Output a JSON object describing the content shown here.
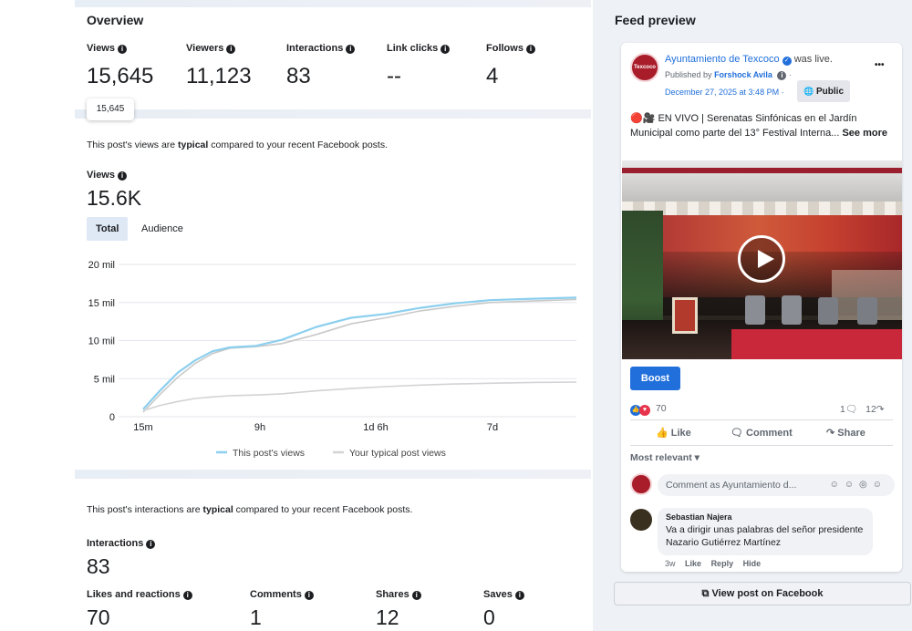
{
  "overview": {
    "title": "Overview",
    "metrics": [
      {
        "label": "Views",
        "value": "15,645"
      },
      {
        "label": "Viewers",
        "value": "11,123"
      },
      {
        "label": "Interactions",
        "value": "83"
      },
      {
        "label": "Link clicks",
        "value": "--"
      },
      {
        "label": "Follows",
        "value": "4"
      }
    ],
    "tooltip": "15,645"
  },
  "views_section": {
    "typical_prefix": "This post's views are ",
    "typical_word": "typical",
    "typical_suffix": " compared to your recent Facebook posts.",
    "label": "Views",
    "value": "15.6K",
    "tabs": [
      "Total",
      "Audience"
    ]
  },
  "chart_data": {
    "type": "line",
    "y_ticks": [
      "0",
      "5 mil",
      "10 mil",
      "15 mil",
      "20 mil"
    ],
    "x_ticks": [
      "15m",
      "9h",
      "1d 6h",
      "7d"
    ],
    "ylim": [
      0,
      20000
    ],
    "x": [
      0,
      4,
      8,
      12,
      16,
      20,
      26,
      32,
      40,
      48,
      56,
      64,
      72,
      80,
      90,
      100
    ],
    "series": [
      {
        "name": "This post's views",
        "color": "#8ccfee",
        "values": [
          1000,
          3500,
          5800,
          7400,
          8600,
          9100,
          9300,
          10100,
          11800,
          13000,
          13500,
          14300,
          14900,
          15300,
          15500,
          15645
        ]
      },
      {
        "name": "Your typical post views",
        "color": "#d3d3d3",
        "values": [
          800,
          1500,
          2000,
          2400,
          2600,
          2750,
          2850,
          3000,
          3400,
          3700,
          3950,
          4150,
          4300,
          4400,
          4500,
          4550
        ]
      },
      {
        "name": "",
        "color": "#c9c9c9",
        "values": [
          600,
          3000,
          5200,
          7000,
          8300,
          9000,
          9200,
          9600,
          10800,
          12200,
          13000,
          13900,
          14500,
          15000,
          15200,
          15400
        ]
      }
    ],
    "legend": [
      "This post's views",
      "Your typical post views"
    ]
  },
  "interactions_section": {
    "typical_prefix": "This post's interactions are ",
    "typical_word": "typical",
    "typical_suffix": " compared to your recent Facebook posts.",
    "label": "Interactions",
    "value": "83",
    "breakdown": [
      {
        "label": "Likes and reactions",
        "value": "70"
      },
      {
        "label": "Comments",
        "value": "1"
      },
      {
        "label": "Shares",
        "value": "12"
      },
      {
        "label": "Saves",
        "value": "0"
      }
    ]
  },
  "feed": {
    "title": "Feed preview",
    "page_name": "Ayuntamiento de Texcoco",
    "was_live": "was live.",
    "published_by": "Published by",
    "publisher": "Forshock Avila",
    "date": "December 27, 2025 at 3:48 PM",
    "audience": "Public",
    "more": "•••",
    "text_main": "🔴🎥 EN VIVO | Serenatas Sinfónicas en el Jardín Municipal como parte del 13° Festival Interna...",
    "see_more": "See more",
    "boost": "Boost",
    "reaction_count": "70",
    "comment_count": "1",
    "share_count": "12",
    "actions": [
      "Like",
      "Comment",
      "Share"
    ],
    "most_relevant": "Most relevant",
    "comment_placeholder": "Comment as Ayuntamiento d...",
    "avatar_text": "Texcoco",
    "comment": {
      "author": "Sebastian Najera",
      "text": "Va a dirigir unas palabras del señor presidente Nazario Gutiérrez Martínez",
      "time": "3w",
      "like": "Like",
      "reply": "Reply",
      "hide": "Hide"
    },
    "view_post": "View post on Facebook"
  }
}
